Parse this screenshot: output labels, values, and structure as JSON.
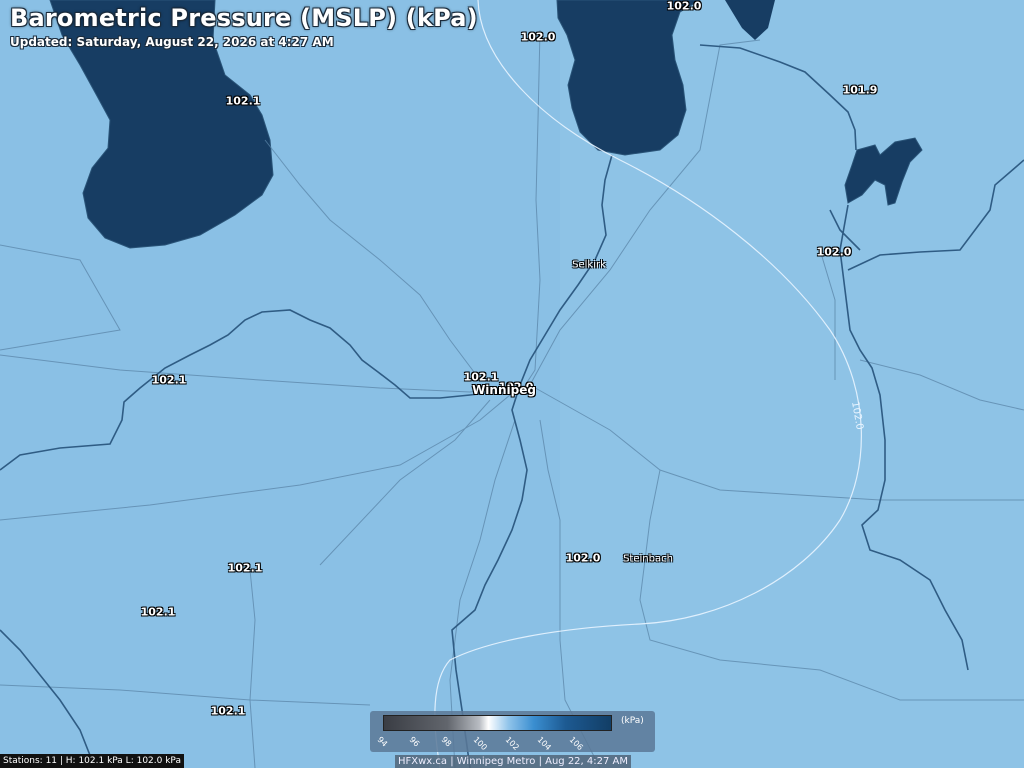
{
  "header": {
    "title": "Barometric Pressure (MSLP) (kPa)",
    "updated": "Updated: Saturday, August 22, 2026 at 4:27 AM"
  },
  "colors": {
    "land": "#8ec3e6",
    "water": "#173d63",
    "roads": "#5a85a8",
    "rivers": "#2f5c84",
    "isobar": "#e8f4ff"
  },
  "stations": [
    {
      "id": "stn-1",
      "value": "102.0"
    },
    {
      "id": "stn-2",
      "value": "102.0"
    },
    {
      "id": "stn-3",
      "value": "102.1"
    },
    {
      "id": "stn-4",
      "value": "101.9"
    },
    {
      "id": "stn-5",
      "value": "102.0"
    },
    {
      "id": "stn-6",
      "value": "102.1"
    },
    {
      "id": "stn-7",
      "value": "102.1"
    },
    {
      "id": "stn-8",
      "value": "102.0"
    },
    {
      "id": "stn-9",
      "value": "102.0"
    },
    {
      "id": "stn-10",
      "value": "102.1"
    },
    {
      "id": "stn-11",
      "value": "102.1"
    },
    {
      "id": "stn-12",
      "value": "102.1"
    }
  ],
  "towns": {
    "selkirk": "Selkirk",
    "winnipeg": "Winnipeg",
    "steinbach": "Steinbach"
  },
  "isobar_label": "102.0",
  "legend": {
    "unit": "(kPa)",
    "ticks": [
      "94",
      "96",
      "98",
      "100",
      "102",
      "104",
      "106"
    ]
  },
  "footer": {
    "stats": "Stations: 11 | H: 102.1 kPa L: 102.0 kPa",
    "credit": "HFXwx.ca | Winnipeg Metro | Aug 22, 4:27 AM"
  }
}
